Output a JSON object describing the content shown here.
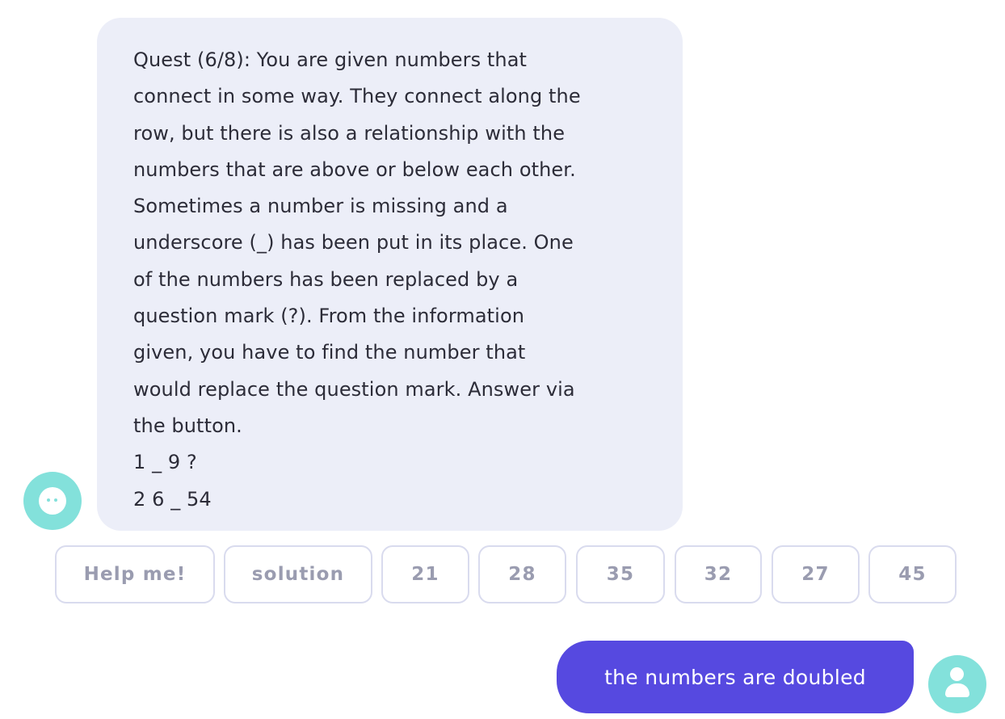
{
  "bot_message": {
    "lines": [
      "Quest (6/8): You are given numbers that",
      "connect in some way. They connect along the",
      "row, but there is also a relationship with the",
      "numbers that are above or below each other.",
      "Sometimes a number is missing and a",
      "underscore (_) has been put in its place. One",
      "of the numbers has been replaced by a",
      "question mark (?). From the information",
      "given, you have to find the number that",
      "would replace the question mark. Answer via",
      "the button.",
      "1 _ 9 ?",
      "2 6 _ 54"
    ],
    "avatar_icon": "bot-face-icon"
  },
  "quick_replies": [
    {
      "label": "Help me!"
    },
    {
      "label": "solution"
    },
    {
      "label": "21"
    },
    {
      "label": "28"
    },
    {
      "label": "35"
    },
    {
      "label": "32"
    },
    {
      "label": "27"
    },
    {
      "label": "45"
    }
  ],
  "user_message": {
    "text": "the numbers are doubled",
    "avatar_icon": "user-icon"
  },
  "colors": {
    "bot_bubble": "#eceef8",
    "user_bubble": "#5649e0",
    "avatar": "#83e1db",
    "button_border": "#d9dbee",
    "button_text": "#9a9cb0"
  }
}
